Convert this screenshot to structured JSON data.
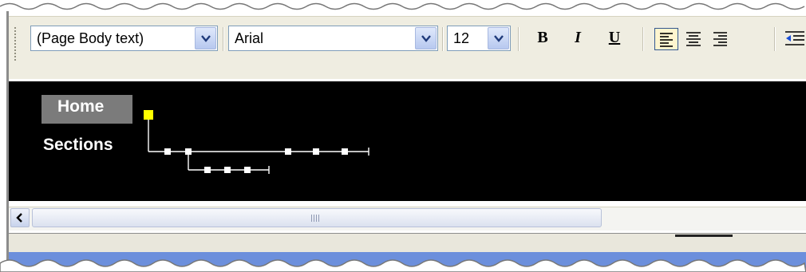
{
  "toolbar": {
    "style_select": {
      "value": "(Page Body text)"
    },
    "font_select": {
      "value": "Arial"
    },
    "size_select": {
      "value": "12"
    },
    "bold_label": "B",
    "italic_label": "I",
    "underline_label": "U",
    "active_alignment": "align-left"
  },
  "site_map": {
    "home_label": "Home",
    "sections_label": "Sections",
    "selected_node_color": "#ffff00",
    "connector_color": "#ffffff",
    "canvas_color": "#000000"
  },
  "colors": {
    "toolbar_bg": "#efede1",
    "accent_blue": "#6c8fdc",
    "home_tab_bg": "#7b7b7b"
  }
}
